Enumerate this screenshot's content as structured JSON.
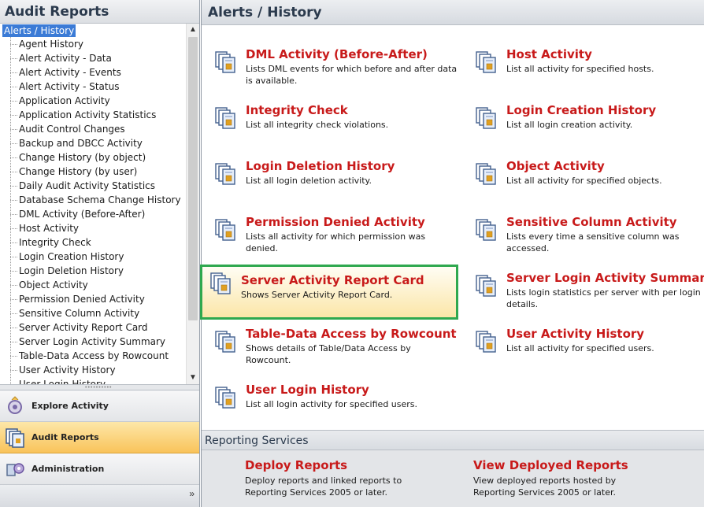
{
  "left_panel": {
    "title": "Audit Reports",
    "tree_root": "Alerts /  History",
    "tree_items": [
      "Agent History",
      "Alert Activity - Data",
      "Alert Activity - Events",
      "Alert Activity - Status",
      "Application Activity",
      "Application Activity Statistics",
      "Audit Control Changes",
      "Backup and DBCC Activity",
      "Change History (by object)",
      "Change History (by user)",
      "Daily Audit Activity Statistics",
      "Database Schema Change History",
      "DML Activity (Before-After)",
      "Host Activity",
      "Integrity Check",
      "Login Creation History",
      "Login Deletion History",
      "Object Activity",
      "Permission Denied Activity",
      "Sensitive Column Activity",
      "Server Activity Report Card",
      "Server Login Activity Summary",
      "Table-Data Access by Rowcount",
      "User Activity History",
      "User Login History"
    ],
    "nav_buttons": [
      {
        "label": "Explore Activity",
        "icon": "explore-activity-icon",
        "active": false
      },
      {
        "label": "Audit Reports",
        "icon": "audit-reports-icon",
        "active": true
      },
      {
        "label": "Administration",
        "icon": "administration-icon",
        "active": false
      }
    ]
  },
  "main": {
    "title": "Alerts /  History",
    "reports_left": [
      {
        "title": "DML Activity (Before-After)",
        "desc": "Lists DML events for which before and after data is available."
      },
      {
        "title": "Integrity Check",
        "desc": "List all integrity check violations."
      },
      {
        "title": "Login Deletion History",
        "desc": "List all login deletion activity."
      },
      {
        "title": "Permission Denied Activity",
        "desc": "Lists all activity for which permission was denied."
      },
      {
        "title": "Server Activity Report Card",
        "desc": "Shows Server Activity Report Card."
      },
      {
        "title": "Table-Data Access by Rowcount",
        "desc": "Shows details of Table/Data Access by Rowcount."
      },
      {
        "title": "User Login History",
        "desc": "List all login activity for specified users."
      }
    ],
    "reports_right": [
      {
        "title": "Host Activity",
        "desc": "List all activity for specified hosts."
      },
      {
        "title": "Login Creation History",
        "desc": "List all login creation activity."
      },
      {
        "title": "Object Activity",
        "desc": "List all activity for specified objects."
      },
      {
        "title": "Sensitive Column Activity",
        "desc": "Lists every time a sensitive column was accessed."
      },
      {
        "title": "Server Login Activity Summary",
        "desc": "Lists login statistics per server with per login details."
      },
      {
        "title": "User Activity History",
        "desc": "List all activity for specified users."
      }
    ],
    "selected_report": "Server Activity Report Card",
    "reporting_services": {
      "title": "Reporting Services",
      "items": [
        {
          "title": "Deploy Reports",
          "desc": "Deploy reports and linked reports to Reporting Services 2005 or later."
        },
        {
          "title": "View Deployed Reports",
          "desc": "View deployed reports hosted by Reporting Services 2005 or later."
        }
      ]
    }
  },
  "colors": {
    "accent_red": "#c81a1a",
    "selection_blue": "#3b7bd6",
    "selected_border_green": "#2fa84f",
    "active_nav_orange": "#f9c35a"
  }
}
